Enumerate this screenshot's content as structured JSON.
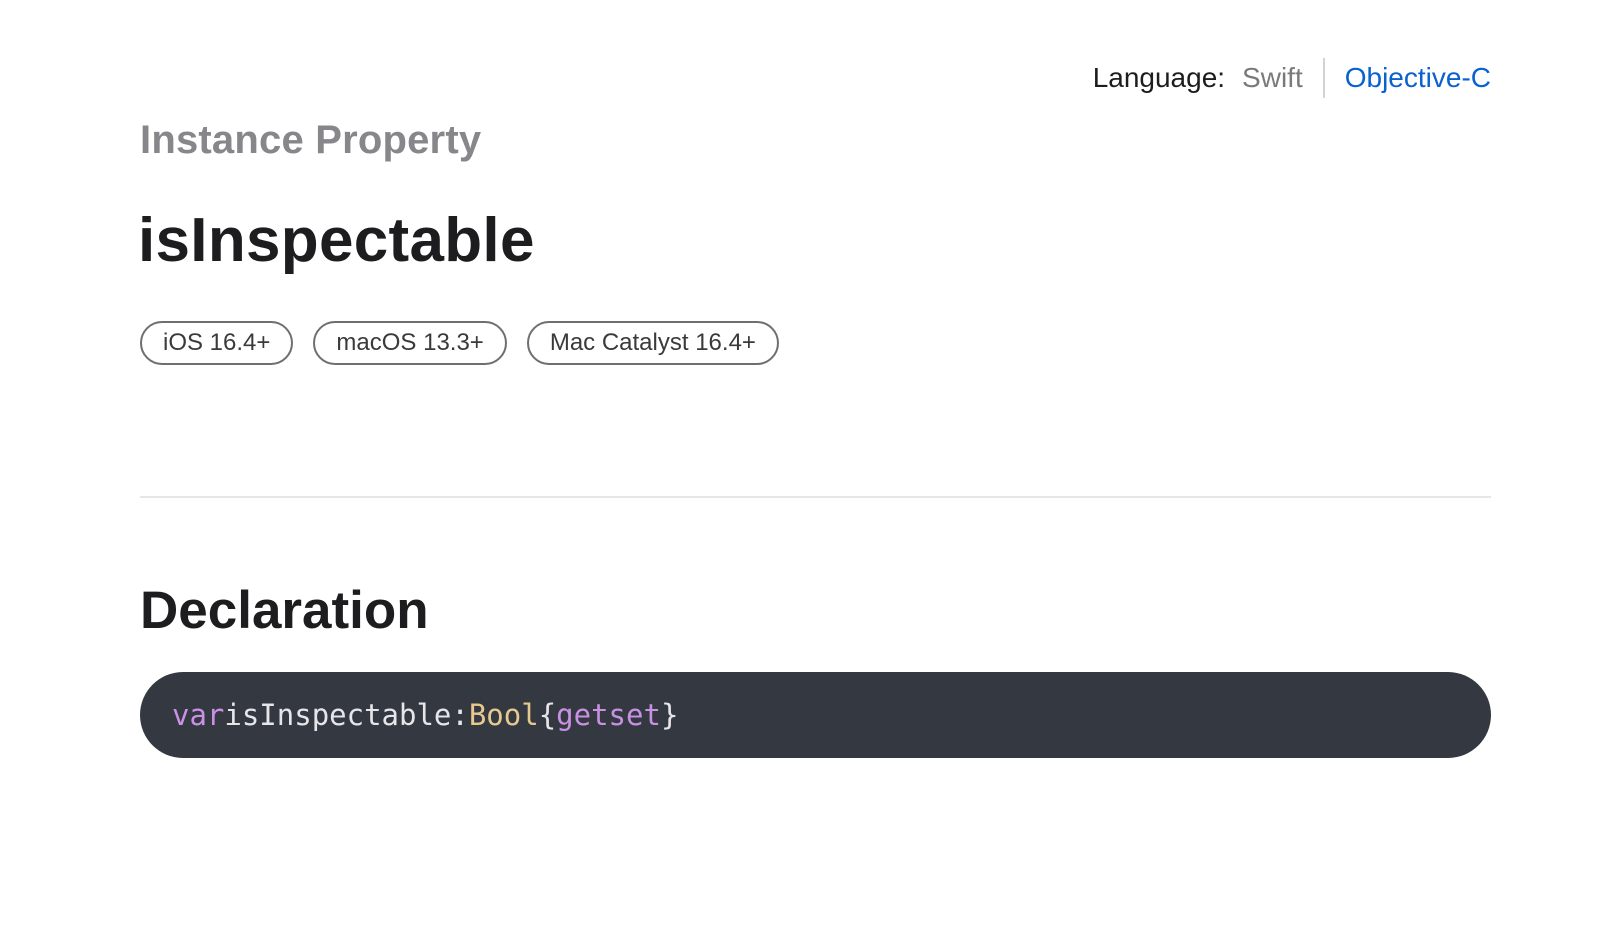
{
  "language_switcher": {
    "label": "Language:",
    "options": [
      {
        "label": "Swift",
        "selected": true
      },
      {
        "label": "Objective-C",
        "selected": false
      }
    ]
  },
  "header": {
    "eyebrow": "Instance Property",
    "title": "isInspectable"
  },
  "availability": [
    "iOS 16.4+",
    "macOS 13.3+",
    "Mac Catalyst 16.4+"
  ],
  "declaration": {
    "heading": "Declaration",
    "tokens": {
      "var_kw": "var",
      "name": "isInspectable",
      "colon": ":",
      "type": "Bool",
      "open_brace": "{",
      "get_kw": "get",
      "set_kw": "set",
      "close_brace": "}"
    }
  },
  "colors": {
    "link": "#0a62d0",
    "code_background": "#343840",
    "keyword": "#c891e3",
    "type": "#e6c98f"
  }
}
